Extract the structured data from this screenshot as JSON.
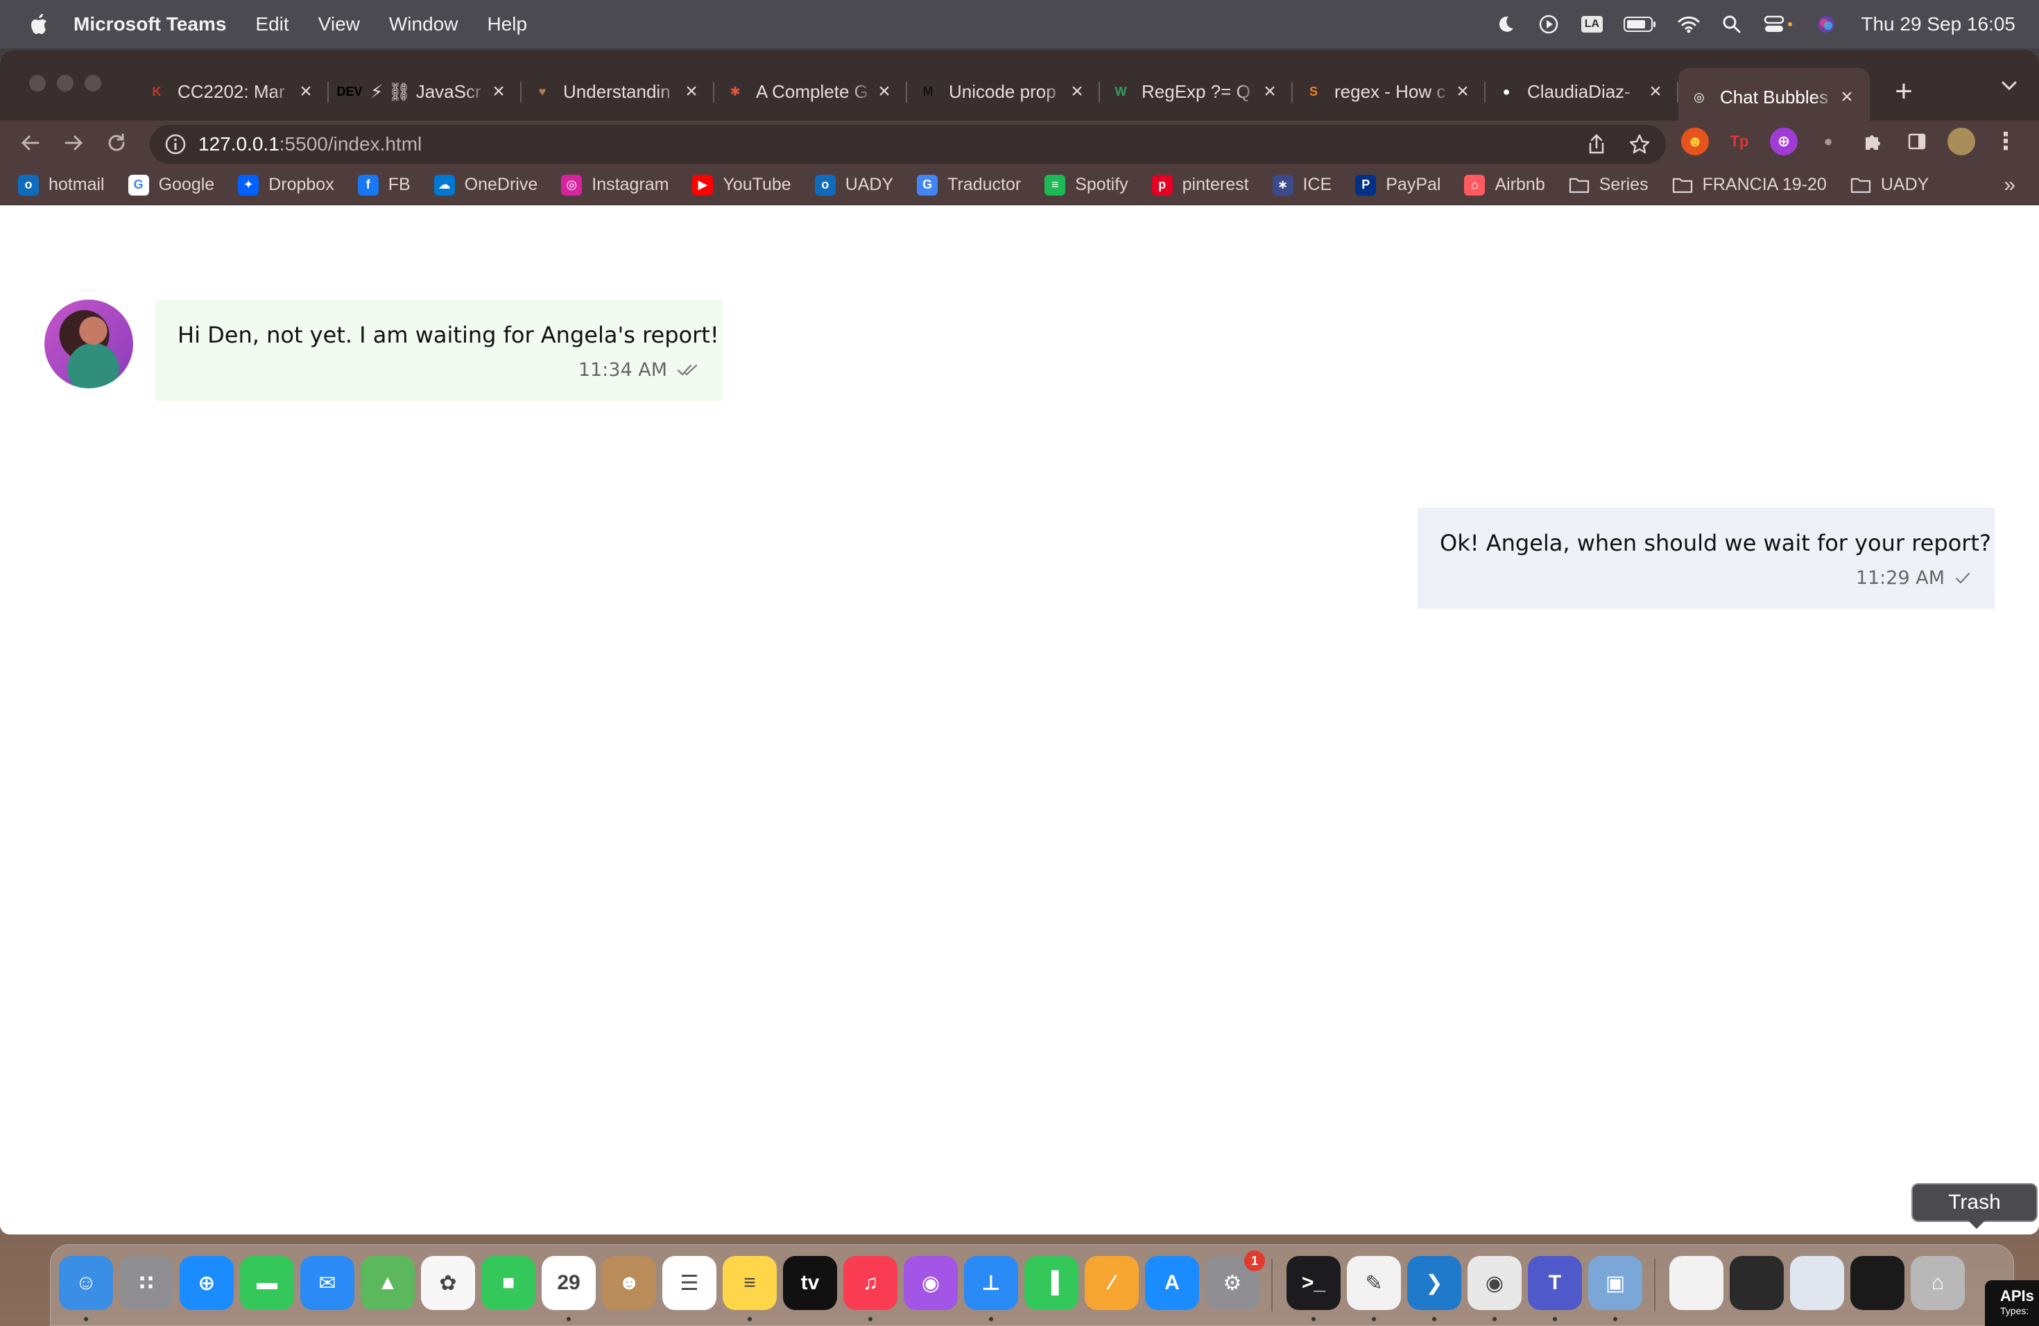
{
  "menubar": {
    "app_name": "Microsoft Teams",
    "menus": [
      "Edit",
      "View",
      "Window",
      "Help"
    ],
    "keyboard_badge": "LA",
    "clock": "Thu 29 Sep  16:05"
  },
  "tabs": [
    {
      "title": "CC2202: Mar",
      "favicon": "K",
      "color": "#c0392b"
    },
    {
      "title": "⚡ ⛓ JavaScr",
      "favicon": "DEV",
      "color": "#000000"
    },
    {
      "title": "Understandin",
      "favicon": "♥",
      "color": "#b08050"
    },
    {
      "title": "A Complete G",
      "favicon": "✱",
      "color": "#e2553d"
    },
    {
      "title": "Unicode prop",
      "favicon": "M",
      "color": "#111111"
    },
    {
      "title": "RegExp ?= Q",
      "favicon": "W",
      "color": "#2e9e5b"
    },
    {
      "title": "regex - How c",
      "favicon": "S",
      "color": "#f48024"
    },
    {
      "title": "ClaudiaDiaz-",
      "favicon": "●",
      "color": "#ffffff"
    },
    {
      "title": "Chat Bubbles",
      "favicon": "◎",
      "color": "#ffffff",
      "active": true
    }
  ],
  "address": {
    "host": "127.0.0.1",
    "path": ":5500/index.html"
  },
  "bookmarks": [
    {
      "label": "hotmail",
      "color": "#0f6cbd",
      "glyph": "o"
    },
    {
      "label": "Google",
      "color": "#ffffff",
      "glyph": "G"
    },
    {
      "label": "Dropbox",
      "color": "#0061fe",
      "glyph": "✦"
    },
    {
      "label": "FB",
      "color": "#1877f2",
      "glyph": "f"
    },
    {
      "label": "OneDrive",
      "color": "#0078d4",
      "glyph": "☁"
    },
    {
      "label": "Instagram",
      "color": "#d6249f",
      "glyph": "◎"
    },
    {
      "label": "YouTube",
      "color": "#ff0000",
      "glyph": "▶"
    },
    {
      "label": "UADY",
      "color": "#0f6cbd",
      "glyph": "o"
    },
    {
      "label": "Traductor",
      "color": "#4285f4",
      "glyph": "G"
    },
    {
      "label": "Spotify",
      "color": "#1db954",
      "glyph": "≡"
    },
    {
      "label": "pinterest",
      "color": "#e60023",
      "glyph": "p"
    },
    {
      "label": "ICE",
      "color": "#3a4a8a",
      "glyph": "∗"
    },
    {
      "label": "PayPal",
      "color": "#003087",
      "glyph": "P"
    },
    {
      "label": "Airbnb",
      "color": "#ff5a5f",
      "glyph": "⌂"
    },
    {
      "label": "Series",
      "color": "folder",
      "glyph": ""
    },
    {
      "label": "FRANCIA 19-20",
      "color": "folder",
      "glyph": ""
    },
    {
      "label": "UADY",
      "color": "folder",
      "glyph": ""
    }
  ],
  "bookmarks_more": "»",
  "chat": {
    "incoming": {
      "text": "Hi Den, not yet. I am waiting for Angela's report!",
      "time": "11:34 AM",
      "status": "double-check-icon"
    },
    "outgoing": {
      "text": "Ok! Angela, when should we wait for your report?",
      "time": "11:29 AM",
      "status": "check-icon"
    }
  },
  "dock": {
    "apps": [
      {
        "name": "Finder",
        "color": "#3a8ee6",
        "glyph": "☺",
        "running": true
      },
      {
        "name": "Launchpad",
        "color": "#8e8e93",
        "glyph": "∷"
      },
      {
        "name": "Safari",
        "color": "#1a8cff",
        "glyph": "⊕"
      },
      {
        "name": "Messages",
        "color": "#34c759",
        "glyph": "▬"
      },
      {
        "name": "Mail",
        "color": "#2a8af6",
        "glyph": "✉"
      },
      {
        "name": "Maps",
        "color": "#5cb85c",
        "glyph": "▲"
      },
      {
        "name": "Photos",
        "color": "#f7f7f7",
        "glyph": "✿"
      },
      {
        "name": "FaceTime",
        "color": "#34c759",
        "glyph": "■"
      },
      {
        "name": "Calendar",
        "color": "#ffffff",
        "glyph": "29",
        "running": true
      },
      {
        "name": "Contacts",
        "color": "#b98c5a",
        "glyph": "☻"
      },
      {
        "name": "Reminders",
        "color": "#ffffff",
        "glyph": "☰"
      },
      {
        "name": "Notes",
        "color": "#ffd54a",
        "glyph": "≡",
        "running": true
      },
      {
        "name": "TV",
        "color": "#111111",
        "glyph": "tv"
      },
      {
        "name": "Music",
        "color": "#fa3c52",
        "glyph": "♫",
        "running": true
      },
      {
        "name": "Podcasts",
        "color": "#a355e6",
        "glyph": "◉"
      },
      {
        "name": "Keynote",
        "color": "#2a8af6",
        "glyph": "⊥",
        "running": true
      },
      {
        "name": "Numbers",
        "color": "#34c759",
        "glyph": "▐"
      },
      {
        "name": "Pages",
        "color": "#f7a531",
        "glyph": "∕"
      },
      {
        "name": "App Store",
        "color": "#1a8cff",
        "glyph": "A"
      },
      {
        "name": "System Settings",
        "color": "#8e8e93",
        "glyph": "⚙",
        "badge": "1"
      },
      {
        "name": "Terminal",
        "color": "#1c1c1e",
        "glyph": ">_",
        "running": true
      },
      {
        "name": "TextEdit",
        "color": "#f2f2f2",
        "glyph": "✎",
        "running": true
      },
      {
        "name": "VS Code",
        "color": "#1f7acc",
        "glyph": "❯",
        "running": true
      },
      {
        "name": "Chrome",
        "color": "#e8e8e8",
        "glyph": "◉",
        "running": true
      },
      {
        "name": "Teams",
        "color": "#5059c9",
        "glyph": "T",
        "running": true
      },
      {
        "name": "Preview",
        "color": "#7aa7d8",
        "glyph": "▣",
        "running": true
      },
      {
        "name": "Document",
        "color": "#f2f2f2",
        "glyph": ""
      },
      {
        "name": "Screenshot 1",
        "color": "#2a2a2a",
        "glyph": ""
      },
      {
        "name": "Screenshot 2",
        "color": "#dfe6f0",
        "glyph": ""
      },
      {
        "name": "Screenshot 3",
        "color": "#1a1a1a",
        "glyph": ""
      },
      {
        "name": "Trash",
        "color": "#b8b8b8",
        "glyph": "⌂"
      }
    ]
  },
  "dock_tooltip": "Trash",
  "corner_widget": {
    "title": "APIs",
    "subtitle": "Types: "
  }
}
